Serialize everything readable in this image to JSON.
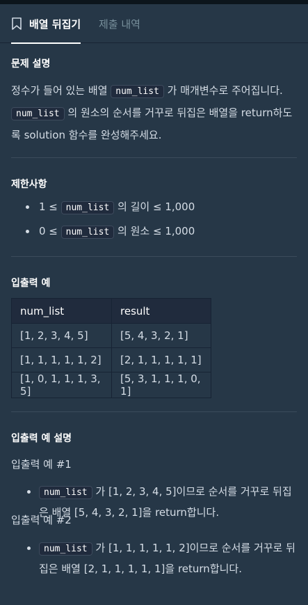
{
  "tabs": {
    "active_label": "배열 뒤집기",
    "inactive_label": "제출 내역"
  },
  "description": {
    "heading": "문제 설명",
    "line1_a": "정수가 들어 있는 배열 ",
    "line1_code": "num_list",
    "line1_b": " 가 매개변수로 주어집니다.",
    "line2_code": "num_list",
    "line2_b": " 의 원소의 순서를 거꾸로 뒤집은 배열을 return하도록 solution 함수를 완성해주세요."
  },
  "constraints": {
    "heading": "제한사항",
    "items": [
      {
        "pre": "1 ≤ ",
        "code": "num_list",
        "post": " 의 길이 ≤ 1,000"
      },
      {
        "pre": "0 ≤ ",
        "code": "num_list",
        "post": " 의 원소 ≤ 1,000"
      }
    ]
  },
  "examples": {
    "heading": "입출력 예",
    "headers": [
      "num_list",
      "result"
    ],
    "rows": [
      [
        "[1, 2, 3, 4, 5]",
        "[5, 4, 3, 2, 1]"
      ],
      [
        "[1, 1, 1, 1, 1, 2]",
        "[2, 1, 1, 1, 1, 1]"
      ],
      [
        "[1, 0, 1, 1, 1, 3, 5]",
        "[5, 3, 1, 1, 1, 0, 1]"
      ]
    ]
  },
  "explanation": {
    "heading": "입출력 예 설명",
    "ex1_title": "입출력 예 #1",
    "ex1_code": "num_list",
    "ex1_text": " 가 [1, 2, 3, 4, 5]이므로 순서를 거꾸로 뒤집은 배열 [5, 4, 3, 2, 1]을 return합니다.",
    "ex2_title": "입출력 예 #2",
    "ex2_code": "num_list",
    "ex2_text": " 가 [1, 1, 1, 1, 1, 2]이므로 순서를 거꾸로 뒤집은 배열 [2, 1, 1, 1, 1, 1]을 return합니다."
  }
}
